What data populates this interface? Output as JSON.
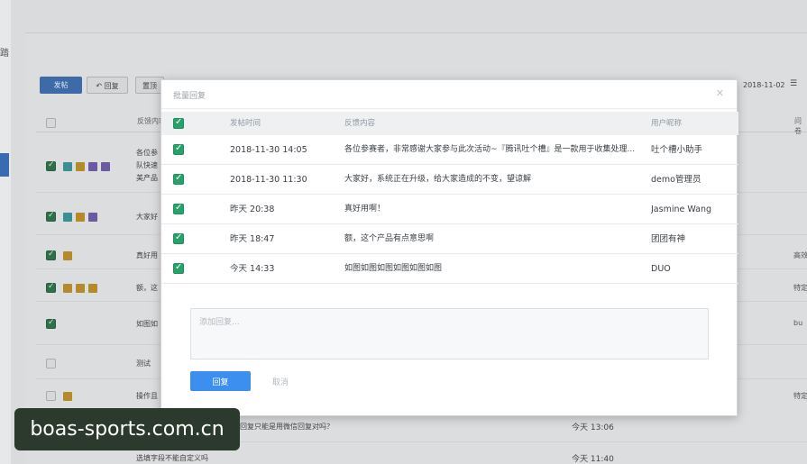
{
  "background": {
    "sidebar_glyph": "踏",
    "toolbar": {
      "primary_label": "发帖",
      "secondary_label": "回复",
      "tertiary_label": "置顶"
    },
    "date_filter": "2018-11-02",
    "date_filter_icon": "calendar-icon",
    "table_header": {
      "content_label": "反馈内容",
      "right_label": "问卷"
    },
    "rows": [
      {
        "text": "各位参",
        "text2": "队快速",
        "text3": "美产品",
        "right": ""
      },
      {
        "text": "大家好",
        "right": ""
      },
      {
        "text": "真好用",
        "right": "高效"
      },
      {
        "text": "额，这",
        "right": "特定"
      },
      {
        "text": "如图如",
        "right": "bu"
      },
      {
        "text": "测试",
        "right": ""
      },
      {
        "text": "操作且",
        "right": "特定"
      },
      {
        "text": "的回复只能是用微信回复对吗？",
        "time": "今天 13:06",
        "right": ""
      },
      {
        "text": "选填字段不能自定义吗",
        "time": "今天 11:40",
        "right": ""
      }
    ]
  },
  "modal": {
    "title": "批量回复",
    "close_icon": "close-icon",
    "headers": {
      "time": "发帖时间",
      "content": "反馈内容",
      "user": "用户昵称"
    },
    "rows": [
      {
        "time": "2018-11-30 14:05",
        "content": "各位参赛者，非常感谢大家参与此次活动~『腾讯吐个槽』是一款用于收集处理...",
        "user": "吐个槽小助手"
      },
      {
        "time": "2018-11-30 11:30",
        "content": "大家好，系统正在升级，给大家造成的不变，望谅解",
        "user": "demo管理员"
      },
      {
        "time": "昨天 20:38",
        "content": "真好用啊！",
        "user": "Jasmine Wang"
      },
      {
        "time": "昨天 18:47",
        "content": "额，这个产品有点意思啊",
        "user": "团团有神"
      },
      {
        "time": "今天 14:33",
        "content": "如图如图如图如图如图如图",
        "user": "DUO"
      }
    ],
    "reply_placeholder": "添加回复...",
    "reply_button": "回复",
    "cancel_button": "取消"
  },
  "watermark": {
    "text": "boas-sports.com.cn"
  },
  "colors": {
    "accent": "#3d8fef",
    "checkbox": "#27a26b",
    "overlay": "#8a8d90"
  }
}
